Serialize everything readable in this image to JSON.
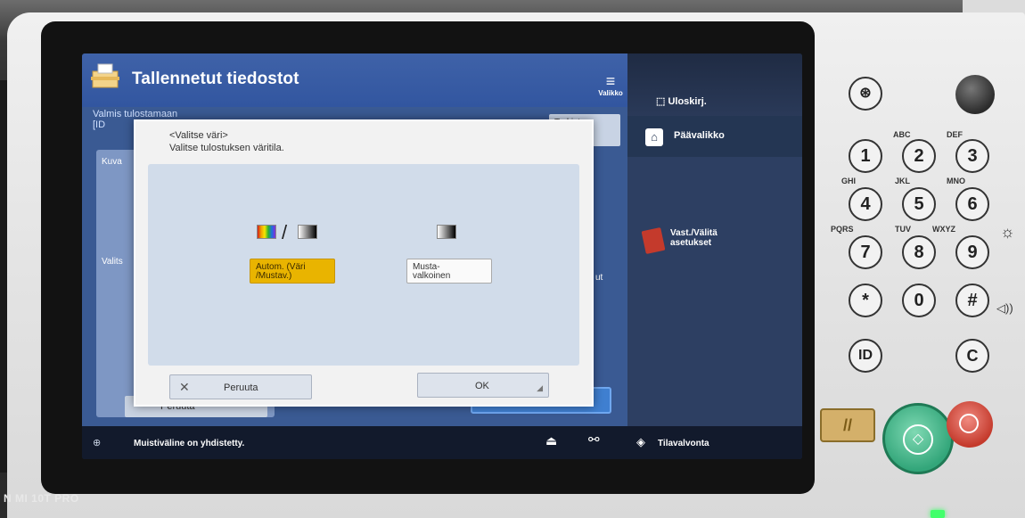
{
  "header": {
    "title": "Tallennetut tiedostot",
    "menu_label": "Valikko",
    "logout_label": "Uloskirj."
  },
  "sidebar": {
    "home_label": "Päävalikko",
    "share_label_line1": "Vast./Välitä",
    "share_label_line2": "asetukset"
  },
  "background": {
    "status_line1": "Valmis tulostamaan",
    "status_line2": "[ID",
    "check_button": "Tarkista",
    "panel_label": "Kuva",
    "select_label": "Valits",
    "cancel_label": "Peruuta",
    "mid_label": "Vi",
    "right_fragment": "ut"
  },
  "dialog": {
    "title": "<Valitse väri>",
    "subtitle": "Valitse tulostuksen väritila.",
    "options": [
      {
        "label_line1": "Autom. (Väri",
        "label_line2": "/Mustav.)",
        "selected": true
      },
      {
        "label_line1": "Musta-",
        "label_line2": "valkoinen",
        "selected": false
      }
    ],
    "cancel_label": "Peruuta",
    "ok_label": "OK"
  },
  "status_bar": {
    "message": "Muistiväline on yhdistetty.",
    "monitor_label": "Tilavalvonta"
  },
  "keypad": {
    "keys": [
      "1",
      "2",
      "3",
      "4",
      "5",
      "6",
      "7",
      "8",
      "9",
      "*",
      "0",
      "#"
    ],
    "letters": [
      "ABC",
      "DEF",
      "GHI",
      "JKL",
      "MNO",
      "PQRS",
      "TUV",
      "WXYZ"
    ],
    "special": {
      "id": "ID",
      "clear": "C",
      "star_top": "⊛"
    }
  },
  "watermark": "N MI 10T PRO",
  "colors": {
    "header_blue": "#3256a0",
    "dialog_bg": "#f2f2f2",
    "selected_option": "#e9b400",
    "start_green": "#33a67a",
    "stop_red": "#c43a2c"
  }
}
